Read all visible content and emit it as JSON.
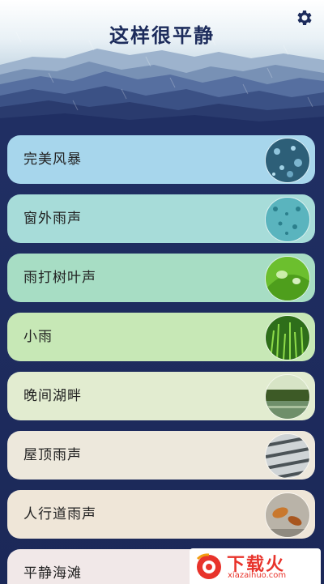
{
  "header": {
    "title": "这样很平静",
    "settings_icon": "gear-icon"
  },
  "sounds": [
    {
      "label": "完美风暴",
      "bg": "#a7d6ec",
      "thumb": "storm-water"
    },
    {
      "label": "窗外雨声",
      "bg": "#a7dcd9",
      "thumb": "window-drops"
    },
    {
      "label": "雨打树叶声",
      "bg": "#a7ddc4",
      "thumb": "leaf-drops"
    },
    {
      "label": "小雨",
      "bg": "#c7e8b6",
      "thumb": "grass-rain"
    },
    {
      "label": "晚间湖畔",
      "bg": "#e2ecd0",
      "thumb": "lake-evening"
    },
    {
      "label": "屋顶雨声",
      "bg": "#ede8dc",
      "thumb": "roof-rain"
    },
    {
      "label": "人行道雨声",
      "bg": "#efe6d8",
      "thumb": "sidewalk-leaves"
    },
    {
      "label": "平静海滩",
      "bg": "#f1e8e8",
      "thumb": "beach"
    }
  ],
  "watermark": {
    "text": "下载火",
    "url": "xiazaihuo.com"
  }
}
